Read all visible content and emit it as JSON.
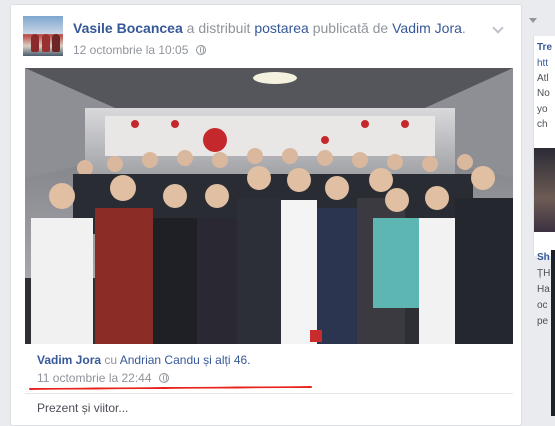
{
  "post": {
    "author": "Vasile Bocancea",
    "action_pre": "a distribuit",
    "action_link": "postarea",
    "action_mid": "publicată de",
    "original_author": "Vadim Jora",
    "timestamp": "12 octombrie la 10:05",
    "privacy_icon": "globe-icon"
  },
  "shared": {
    "author": "Vadim Jora",
    "with_text": "cu",
    "tagged": "Andrian Candu",
    "others": "și alți 46.",
    "timestamp": "11 octombrie la 22:44",
    "caption": "Prezent și viitor..."
  },
  "right_column": {
    "items": [
      "Tre",
      "htt",
      "Atl",
      "No",
      "yo",
      "ch",
      "Sh",
      "ȚH",
      "Ha",
      "oc",
      "pe"
    ]
  },
  "colors": {
    "link": "#365899",
    "meta": "#90949c",
    "annotation": "#e8231c"
  }
}
